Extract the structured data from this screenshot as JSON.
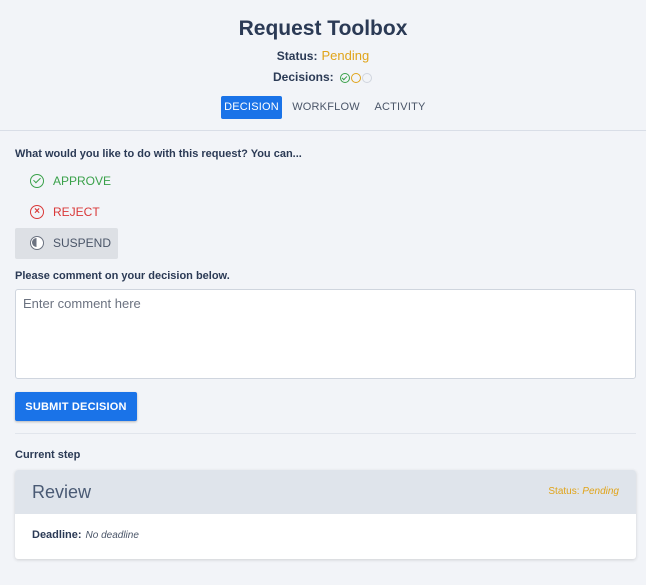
{
  "header": {
    "title": "Request Toolbox",
    "status_label": "Status:",
    "status_value": "Pending",
    "decisions_label": "Decisions:",
    "decision_states": [
      "approved",
      "pending",
      "empty"
    ],
    "status_color": "#e0a41a"
  },
  "tabs": [
    {
      "label": "DECISION",
      "active": true
    },
    {
      "label": "WORKFLOW",
      "active": false
    },
    {
      "label": "ACTIVITY",
      "active": false
    }
  ],
  "decision": {
    "question": "What would you like to do with this request? You can...",
    "options": [
      {
        "label": "APPROVE",
        "icon": "check-circle-icon",
        "color": "#3aa14a"
      },
      {
        "label": "REJECT",
        "icon": "x-circle-icon",
        "color": "#d93838"
      },
      {
        "label": "SUSPEND",
        "icon": "pie-clock-icon",
        "selected": true
      }
    ],
    "comment_label": "Please comment on your decision below.",
    "comment_placeholder": "Enter comment here",
    "comment_value": "",
    "submit_label": "SUBMIT DECISION"
  },
  "current_step": {
    "label": "Current step",
    "name": "Review",
    "status_label": "Status:",
    "status_value": "Pending",
    "deadline_label": "Deadline:",
    "deadline_value": "No deadline"
  },
  "colors": {
    "accent": "#1a73e8",
    "approve": "#3aa14a",
    "reject": "#d93838",
    "pending": "#e0a41a"
  }
}
